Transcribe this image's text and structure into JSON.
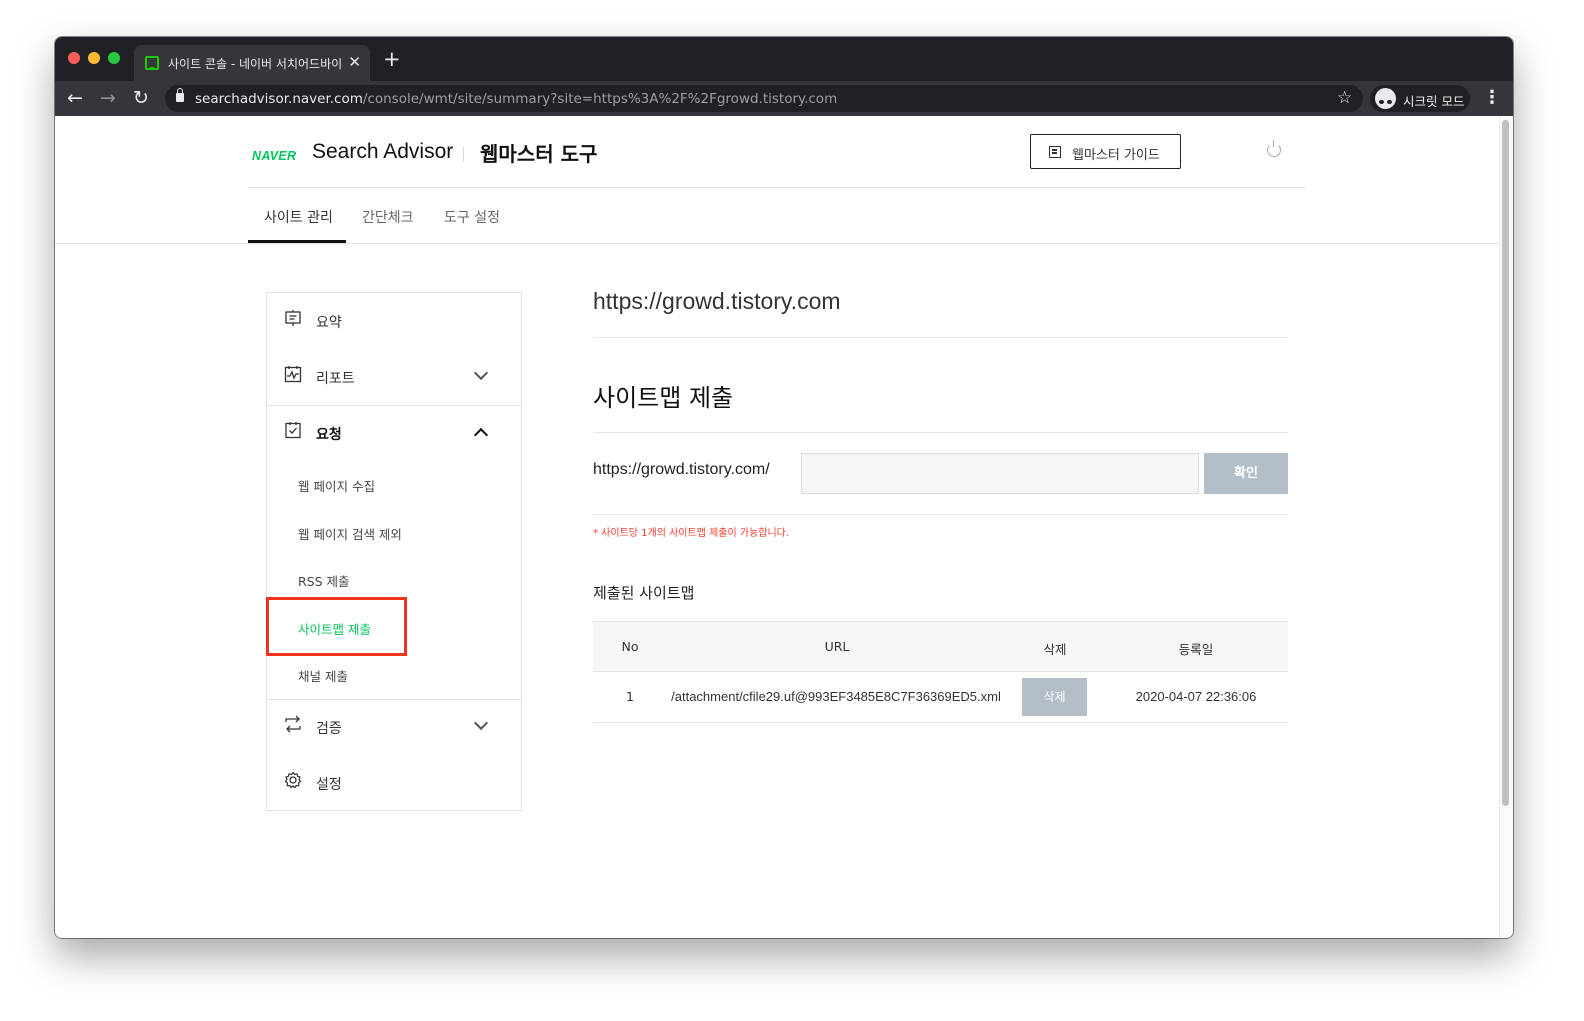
{
  "browser": {
    "tab_title": "사이트 콘솔 - 네이버 서치어드바이저",
    "tab_close": "✕",
    "new_tab": "+",
    "url_host": "searchadvisor.naver.com",
    "url_path": "/console/wmt/site/summary?site=https%3A%2F%2Fgrowd.tistory.com",
    "incognito_label": "시크릿 모드"
  },
  "header": {
    "brand_naver": "NAVER",
    "brand_name": "Search Advisor",
    "tool_name": "웹마스터 도구",
    "guide_button": "웹마스터 가이드"
  },
  "gnb": {
    "items": [
      "사이트 관리",
      "간단체크",
      "도구 설정"
    ]
  },
  "sidebar": {
    "summary": "요약",
    "report": "리포트",
    "request": "요청",
    "request_items": [
      "웹 페이지 수집",
      "웹 페이지 검색 제외",
      "RSS 제출",
      "사이트맵 제출",
      "채널 제출"
    ],
    "verify": "검증",
    "settings": "설정"
  },
  "main": {
    "site_url": "https://growd.tistory.com",
    "section_title": "사이트맵 제출",
    "input_prefix": "https://growd.tistory.com/",
    "input_value": "",
    "confirm_button": "확인",
    "note": "* 사이트당 1개의 사이트맵 제출이 가능합니다.",
    "submitted_title": "제출된 사이트맵",
    "table": {
      "headers": [
        "No",
        "URL",
        "삭제",
        "등록일"
      ],
      "rows": [
        {
          "no": "1",
          "url": "/attachment/cfile29.uf@993EF3485E8C7F36369ED5.xml",
          "delete": "삭제",
          "date": "2020-04-07 22:36:06"
        }
      ]
    }
  },
  "colors": {
    "naver_green": "#03c75a",
    "highlight_red": "#ee3322",
    "button_gray": "#b3bec9",
    "note_red": "#ff3b30"
  }
}
